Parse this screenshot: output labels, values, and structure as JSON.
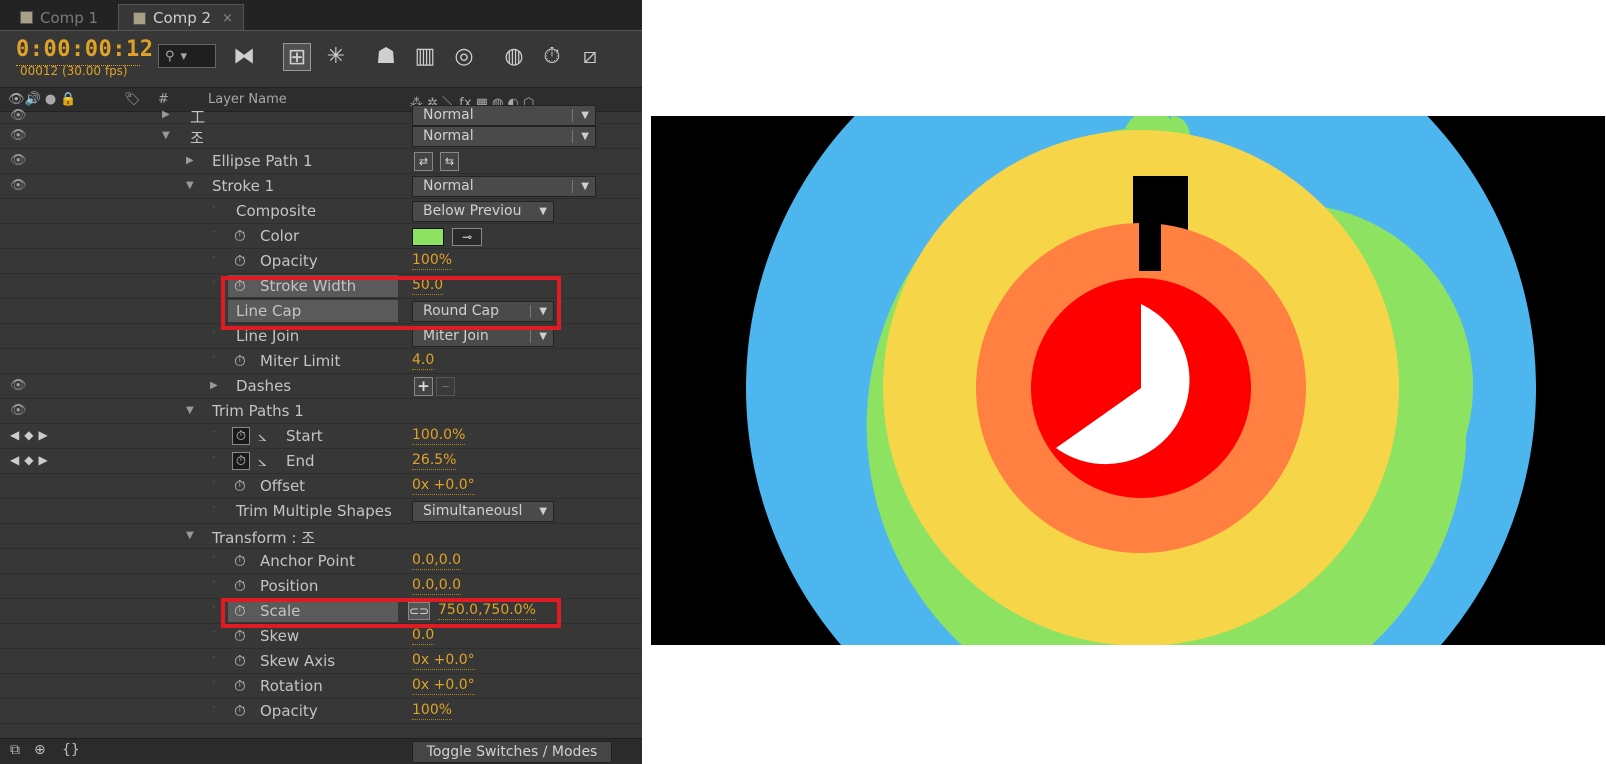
{
  "tabs": [
    {
      "label": "Comp 1",
      "active": false
    },
    {
      "label": "Comp 2",
      "active": true
    }
  ],
  "tab_close": "×",
  "timecode": "0:00:00:12",
  "frame_info": "00012 (30.00 fps)",
  "search_icon_glyph": "⚲",
  "search_dropdown_glyph": "▾",
  "column_headers": {
    "hash": "#",
    "layer_name": "Layer Name",
    "switches": "⁂ ✲ ＼ fx ▦ ◍ ◐ ⬡"
  },
  "layers": {
    "row0_label": "工",
    "row0_mode": "Normal",
    "row1_label": "조",
    "row1_mode": "Normal",
    "ellipse_path": "Ellipse Path 1",
    "stroke": "Stroke 1",
    "stroke_mode": "Normal",
    "composite_label": "Composite",
    "composite_value": "Below Previou",
    "color_label": "Color",
    "color_value": "#8ee262",
    "opacity_label": "Opacity",
    "opacity_value": "100%",
    "stroke_width_label": "Stroke Width",
    "stroke_width_value": "50.0",
    "line_cap_label": "Line Cap",
    "line_cap_value": "Round Cap",
    "line_join_label": "Line Join",
    "line_join_value": "Miter Join",
    "miter_limit_label": "Miter Limit",
    "miter_limit_value": "4.0",
    "dashes_label": "Dashes",
    "trim_paths_label": "Trim Paths 1",
    "start_label": "Start",
    "start_value": "100.0%",
    "end_label": "End",
    "end_value": "26.5%",
    "offset_label": "Offset",
    "offset_value": "0x +0.0°",
    "trim_multiple_label": "Trim Multiple Shapes",
    "trim_multiple_value": "Simultaneousl",
    "transform_label": "Transform : 조",
    "anchor_label": "Anchor Point",
    "anchor_value": "0.0,0.0",
    "position_label": "Position",
    "position_value": "0.0,0.0",
    "scale_label": "Scale",
    "scale_value": "750.0,750.0%",
    "skew_label": "Skew",
    "skew_value": "0.0",
    "skew_axis_label": "Skew Axis",
    "skew_axis_value": "0x +0.0°",
    "rotation_label": "Rotation",
    "rotation_value": "0x +0.0°",
    "t_opacity_label": "Opacity",
    "t_opacity_value": "100%"
  },
  "toggle_label": "Toggle Switches / Modes",
  "glyphs": {
    "eye": "👁",
    "tri_right": "▶",
    "tri_down": "▼",
    "stopwatch": "⏱",
    "graph": "📈",
    "dropdown_arrow": "▼",
    "plus": "+",
    "minus": "−",
    "kf_nav": "◀◆▶",
    "chain": "⊂⊃",
    "eyedropper": "⊸",
    "stop_dot": "·"
  },
  "preview_colors": {
    "blue": "#4db6ef",
    "green": "#8ee262",
    "yellow": "#f7d548",
    "orange": "#ff8040",
    "red": "#ff0000",
    "white": "#ffffff",
    "background": "#000000"
  },
  "highlight_color": "#e01b24"
}
